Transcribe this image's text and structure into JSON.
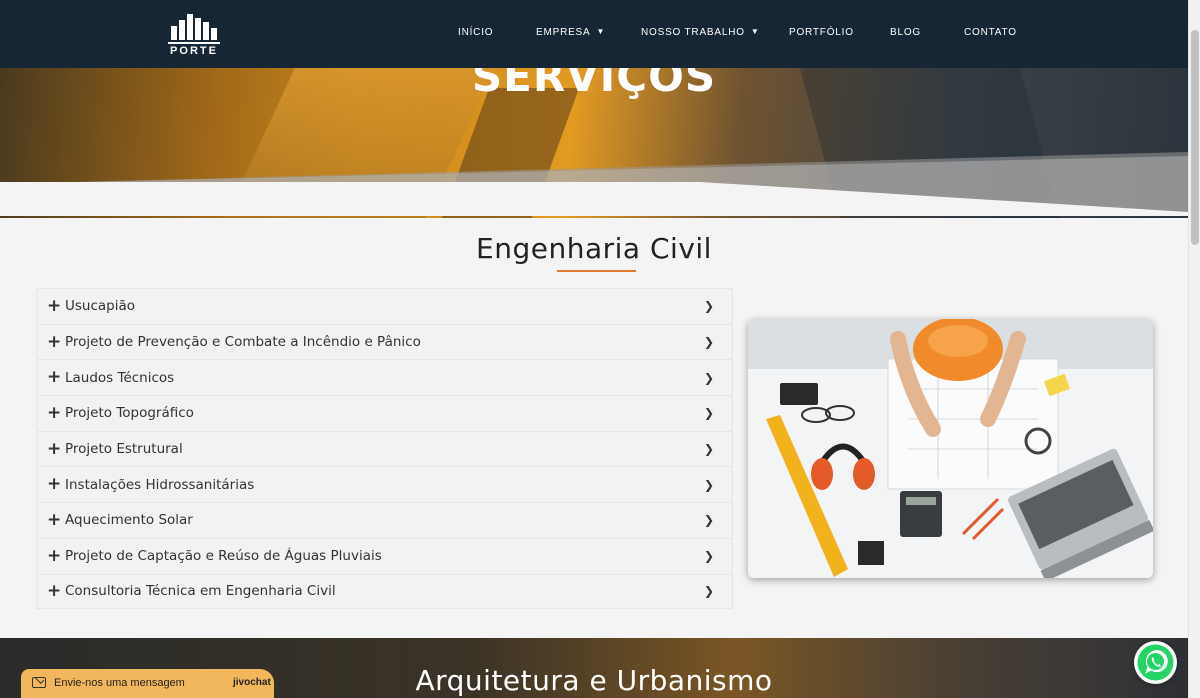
{
  "brand": {
    "logo_text": "PORTE"
  },
  "nav": {
    "items": [
      {
        "label": "INÍCIO",
        "dropdown": false
      },
      {
        "label": "EMPRESA",
        "dropdown": true
      },
      {
        "label": "NOSSO TRABALHO",
        "dropdown": true
      },
      {
        "label": "PORTFÓLIO",
        "dropdown": false
      },
      {
        "label": "BLOG",
        "dropdown": false
      },
      {
        "label": "CONTATO",
        "dropdown": false
      }
    ]
  },
  "hero": {
    "title": "SERVIÇOS"
  },
  "section": {
    "title": "Engenharia Civil",
    "accent_color": "#e07a2e",
    "items": [
      "Usucapião",
      "Projeto de Prevenção e Combate a Incêndio e Pânico",
      "Laudos Técnicos",
      "Projeto Topográfico",
      "Projeto Estrutural",
      "Instalações Hidrossanitárias",
      "Aquecimento Solar",
      "Projeto de Captação e Reúso de Águas Pluviais",
      "Consultoria Técnica em Engenharia Civil"
    ]
  },
  "next_section": {
    "title": "Arquitetura e Urbanismo"
  },
  "chat": {
    "label": "Envie-nos uma mensagem",
    "brand": "jivochat",
    "color": "#f2b75c"
  },
  "colors": {
    "header_bg": "#162634",
    "whatsapp": "#25d366"
  }
}
